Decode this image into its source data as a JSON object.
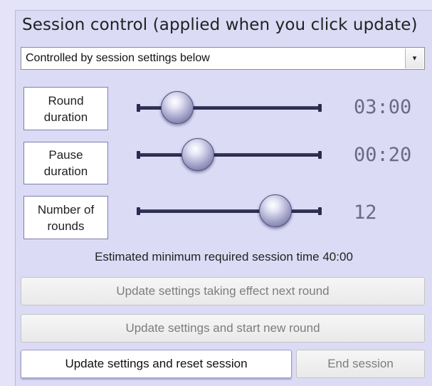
{
  "panel": {
    "title": "Session control (applied when you click update)"
  },
  "mode_select": {
    "value": "Controlled by session settings below",
    "arrow_icon": "▾"
  },
  "settings": [
    {
      "label": "Round duration",
      "value": "03:00",
      "slider_fraction": 0.22
    },
    {
      "label": "Pause duration",
      "value": "00:20",
      "slider_fraction": 0.33
    },
    {
      "label": "Number of rounds",
      "value": "12",
      "slider_fraction": 0.75
    }
  ],
  "estimate_text": "Estimated minimum required session time 40:00",
  "buttons": {
    "update_next_round": "Update settings taking effect next round",
    "update_new_round": "Update settings and start new round",
    "update_reset": "Update  settings and reset session",
    "end_session": "End session"
  },
  "colors": {
    "panel_background": "#dcdbf5",
    "slider_track": "#2b2b50",
    "value_text": "#6a6a88"
  }
}
